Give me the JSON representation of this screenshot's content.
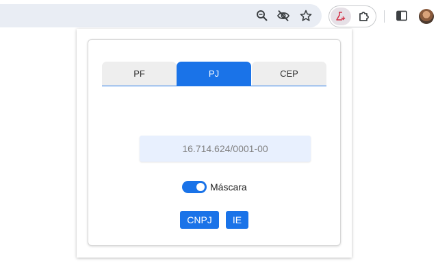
{
  "colors": {
    "accent": "#1a73e8",
    "tab_inactive": "#eeeeee",
    "input_bg": "#e8f0fe",
    "omnibox_bg": "#e9edf4"
  },
  "browser": {
    "icons": [
      "zoom-icon",
      "eye-off-icon",
      "star-icon",
      "flask-extension-icon",
      "puzzle-extension-icon",
      "side-panel-icon",
      "avatar"
    ]
  },
  "popup": {
    "tabs": [
      {
        "label": "PF",
        "active": false
      },
      {
        "label": "PJ",
        "active": true
      },
      {
        "label": "CEP",
        "active": false
      }
    ],
    "input": {
      "value": "",
      "placeholder": "16.714.624/0001-00"
    },
    "mask_toggle": {
      "label": "Máscara",
      "checked": true
    },
    "buttons": {
      "cnpj_label": "CNPJ",
      "ie_label": "IE"
    }
  }
}
